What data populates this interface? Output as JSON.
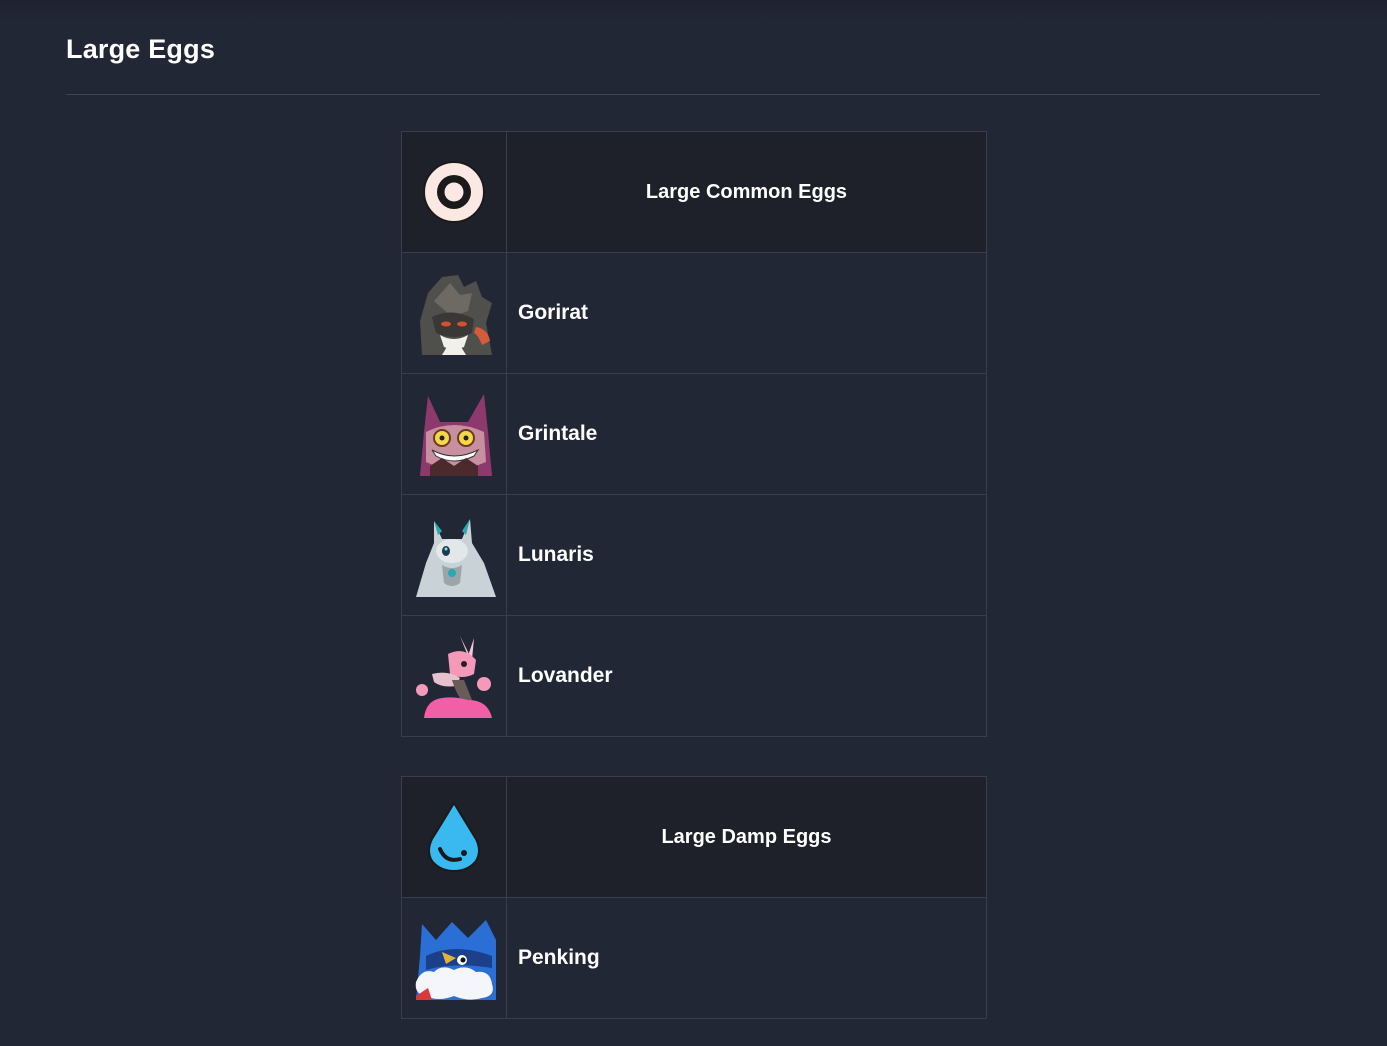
{
  "page": {
    "title": "Large Eggs"
  },
  "egg_groups": [
    {
      "label": "Large Common Eggs",
      "icon": "common-element-icon",
      "icon_color": "#fbe8e2",
      "pals": [
        {
          "name": "Gorirat",
          "portrait": "gorirat-portrait"
        },
        {
          "name": "Grintale",
          "portrait": "grintale-portrait"
        },
        {
          "name": "Lunaris",
          "portrait": "lunaris-portrait"
        },
        {
          "name": "Lovander",
          "portrait": "lovander-portrait"
        }
      ]
    },
    {
      "label": "Large Damp Eggs",
      "icon": "water-drop-icon",
      "icon_color": "#3ab8f0",
      "pals": [
        {
          "name": "Penking",
          "portrait": "penking-portrait"
        }
      ]
    }
  ]
}
